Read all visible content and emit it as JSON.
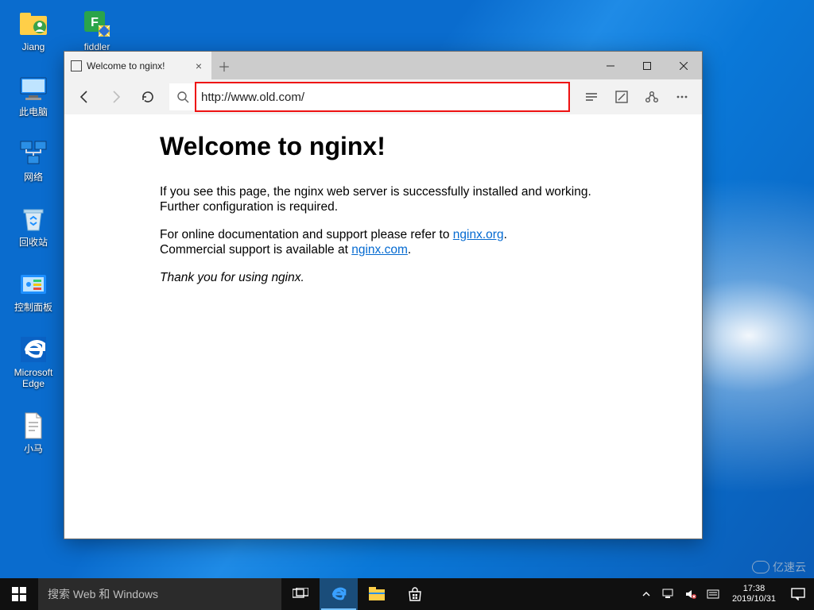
{
  "desktop": {
    "icons": [
      {
        "label": "Jiang",
        "kind": "user"
      },
      {
        "label": "fiddler",
        "kind": "fiddler"
      },
      {
        "label": "此电脑",
        "kind": "thispc"
      },
      {
        "label": "网络",
        "kind": "network"
      },
      {
        "label": "回收站",
        "kind": "recycle"
      },
      {
        "label": "控制面板",
        "kind": "control"
      },
      {
        "label": "Microsoft\nEdge",
        "kind": "edge"
      },
      {
        "label": "小马",
        "kind": "textfile"
      }
    ]
  },
  "browser": {
    "tab_title": "Welcome to nginx!",
    "url": "http://www.old.com/",
    "page": {
      "heading": "Welcome to nginx!",
      "p1": "If you see this page, the nginx web server is successfully installed and working. Further configuration is required.",
      "p2_pre": "For online documentation and support please refer to ",
      "p2_link1": "nginx.org",
      "p2_mid": ".\nCommercial support is available at ",
      "p2_link2": "nginx.com",
      "p2_post": ".",
      "thanks": "Thank you for using nginx."
    }
  },
  "taskbar": {
    "search_placeholder": "搜索 Web 和 Windows",
    "time": "17:38",
    "date": "2019/10/31"
  },
  "watermark": "亿速云"
}
